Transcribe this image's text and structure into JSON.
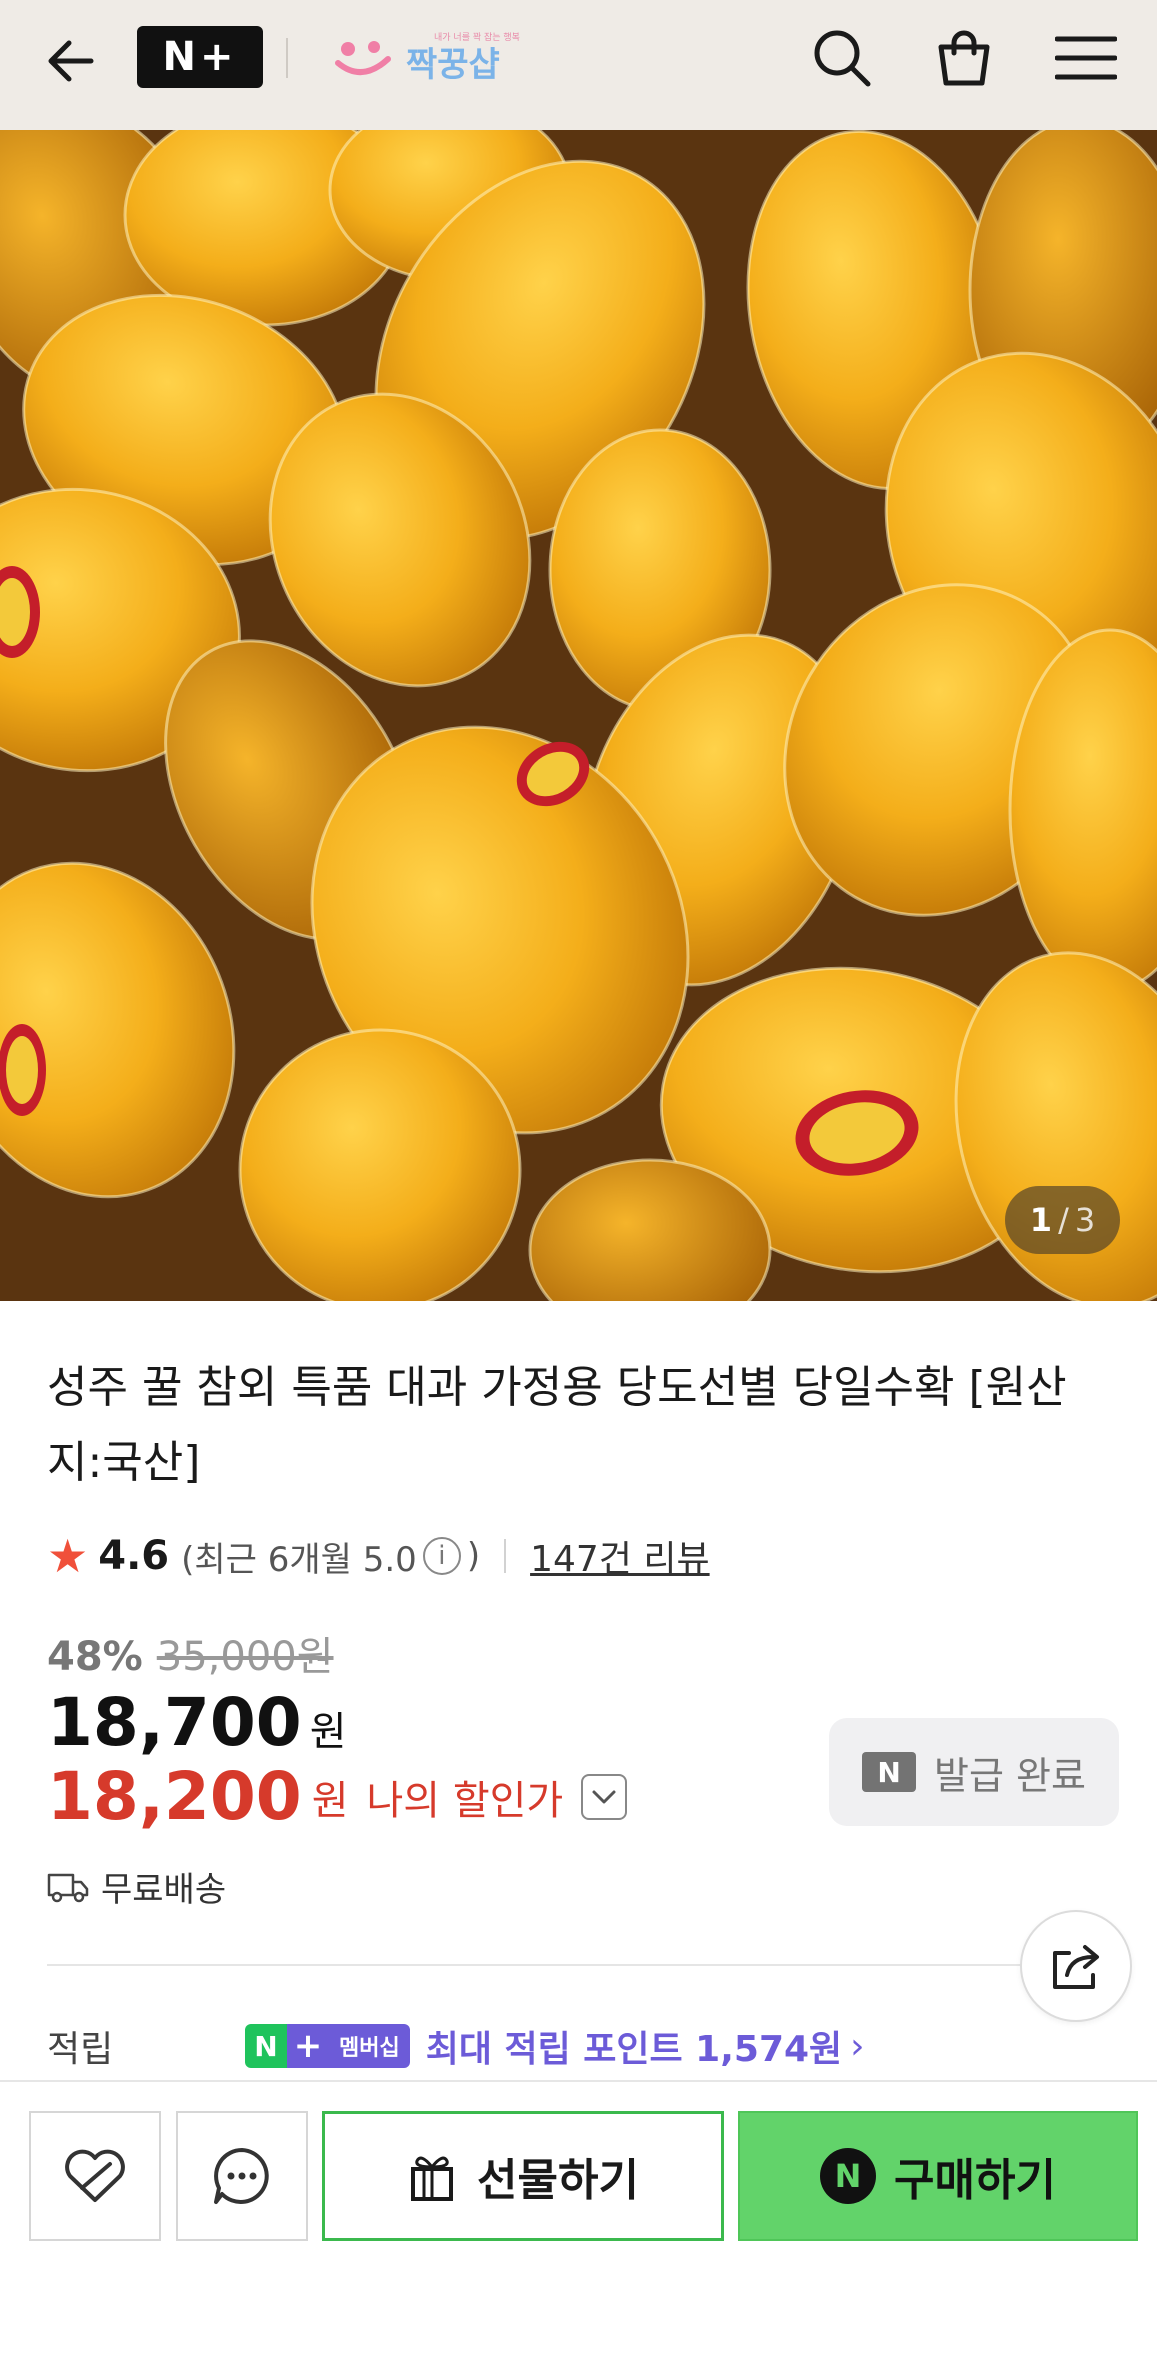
{
  "header": {
    "brand_logo": "N+",
    "store_tagline": "내가 너를 꽉 잡는 행복",
    "store_name": "짝꿍샵"
  },
  "gallery": {
    "current": "1",
    "separator": "/",
    "total": "3"
  },
  "product": {
    "title": "성주 꿀 참외 특품 대과 가정용 당도선별 당일수확 [원산지:국산]",
    "rating": "4.6",
    "recent_rating_prefix": "(최근 6개월 5.0",
    "recent_rating_suffix": ")",
    "review_link": "147건 리뷰",
    "discount_pct": "48%",
    "original_price": "35,000원",
    "price": "18,700",
    "price_unit": "원",
    "my_price": "18,200",
    "my_price_unit": "원",
    "my_price_label": "나의 할인가",
    "coupon_badge": "N",
    "coupon_label": "발급 완료",
    "delivery": "무료배송"
  },
  "points": {
    "label": "적립",
    "badge_n": "N",
    "badge_plus": "+",
    "badge_text": "멤버십",
    "text": "최대 적립 포인트 1,574원",
    "chevron": "›"
  },
  "bottom_bar": {
    "gift_label": "선물하기",
    "buy_badge": "N",
    "buy_label": "구매하기"
  },
  "colors": {
    "header_bg": "#efebe6",
    "price_red": "#d63a2b",
    "naver_green": "#62d36a",
    "membership_purple": "#6c5bd8"
  },
  "icons": [
    "back-arrow-icon",
    "search-icon",
    "cart-icon",
    "menu-icon",
    "star-icon",
    "info-icon",
    "chevron-down-icon",
    "delivery-truck-icon",
    "share-icon",
    "heart-icon",
    "chat-icon",
    "gift-icon"
  ]
}
